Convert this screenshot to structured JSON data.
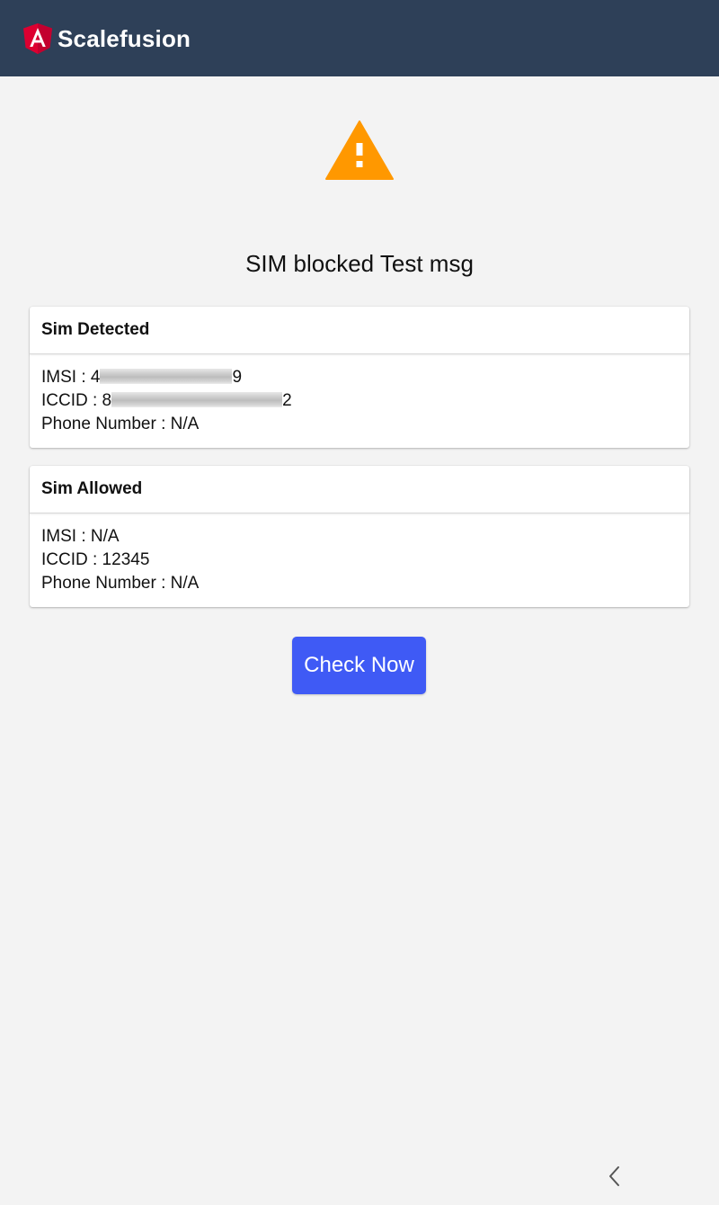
{
  "header": {
    "app_title": "Scalefusion",
    "logo_icon": "angular-shield-icon",
    "background_color": "#2e4058"
  },
  "alert": {
    "icon": "warning-triangle-icon",
    "icon_color": "#ff9800",
    "title": "SIM blocked Test msg"
  },
  "sim_detected": {
    "header": "Sim Detected",
    "imsi_prefix": "IMSI : 4",
    "imsi_suffix": "9",
    "iccid_prefix": "ICCID : 8",
    "iccid_suffix": "2",
    "phone_number": "Phone Number : N/A"
  },
  "sim_allowed": {
    "header": "Sim Allowed",
    "imsi": "IMSI : N/A",
    "iccid": "ICCID : 12345",
    "phone_number": "Phone Number : N/A"
  },
  "actions": {
    "check_now_label": "Check Now",
    "button_color": "#3f5af5"
  },
  "nav_bar": {
    "back_icon": "back-chevron-icon"
  }
}
